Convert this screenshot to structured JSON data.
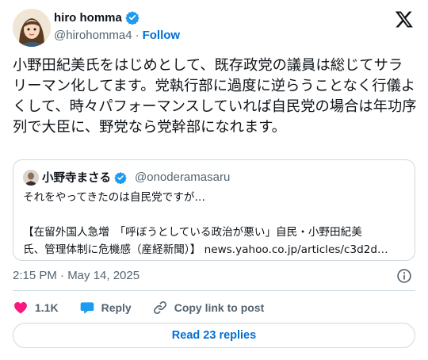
{
  "author": {
    "display_name": "hiro homma",
    "handle": "@hirohomma4",
    "separator": "·",
    "follow_label": "Follow",
    "verified_color": "#1d9bf0"
  },
  "tweet": {
    "text": "小野田紀美氏をはじめとして、既存政党の議員は総じてサラリーマン化してます。党執行部に過度に逆らうことなく行儀よくして、時々パフォーマンスしていれば自民党の場合は年功序列で大臣に、野党なら党幹部になれます。",
    "timestamp": "2:15 PM · May 14, 2025"
  },
  "quote": {
    "display_name": "小野寺まさる",
    "handle": "@onoderamasaru",
    "lines": [
      "それをやってきたのは自民党ですが…",
      "",
      "【在留外国人急増　「呼ぼうとしている政治が悪い」自民・小野田紀美",
      "氏、管理体制に危機感（産経新聞）】 news.yahoo.co.jp/articles/c3d2d…"
    ]
  },
  "actions": {
    "like_count": "1.1K",
    "reply_label": "Reply",
    "copy_label": "Copy link to post",
    "like_color": "#f91880",
    "reply_color": "#1d9bf0"
  },
  "read_replies_label": "Read 23 replies",
  "icons": {
    "logo": "x-logo-icon",
    "verified": "verified-badge-icon",
    "info": "info-icon",
    "like": "heart-icon",
    "reply": "speech-bubble-icon",
    "copy": "link-icon"
  }
}
